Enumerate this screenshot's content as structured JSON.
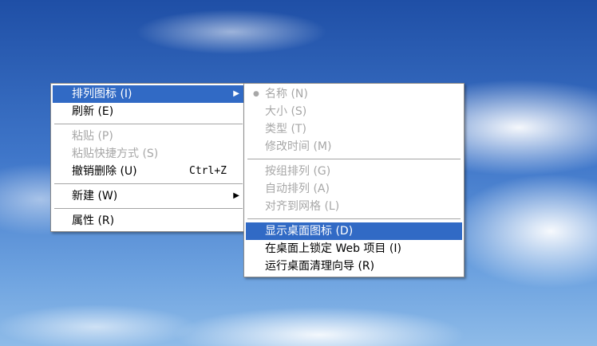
{
  "main_menu": {
    "items": [
      {
        "label": "排列图标 (I)",
        "has_submenu": true,
        "state": "selected"
      },
      {
        "label": "刷新 (E)",
        "state": "enabled"
      },
      {
        "label": "粘贴 (P)",
        "state": "disabled"
      },
      {
        "label": "粘贴快捷方式 (S)",
        "state": "disabled"
      },
      {
        "label": "撤销删除 (U)",
        "shortcut": "Ctrl+Z",
        "state": "enabled"
      },
      {
        "label": "新建 (W)",
        "has_submenu": true,
        "state": "enabled"
      },
      {
        "label": "属性 (R)",
        "state": "enabled"
      }
    ]
  },
  "submenu": {
    "items": [
      {
        "label": "名称 (N)",
        "checked": true,
        "bullet": "●",
        "state": "disabled"
      },
      {
        "label": "大小 (S)",
        "state": "disabled"
      },
      {
        "label": "类型 (T)",
        "state": "disabled"
      },
      {
        "label": "修改时间 (M)",
        "state": "disabled"
      },
      {
        "label": "按组排列 (G)",
        "state": "disabled"
      },
      {
        "label": "自动排列 (A)",
        "state": "disabled"
      },
      {
        "label": "对齐到网格 (L)",
        "state": "disabled"
      },
      {
        "label": "显示桌面图标 (D)",
        "state": "selected"
      },
      {
        "label": "在桌面上锁定 Web 项目 (I)",
        "state": "enabled"
      },
      {
        "label": "运行桌面清理向导 (R)",
        "state": "enabled"
      }
    ]
  },
  "icons": {
    "submenu_arrow": "▶"
  },
  "colors": {
    "highlight": "#316ac5",
    "disabled_text": "#a7a7a7",
    "menu_bg": "#ffffff"
  }
}
